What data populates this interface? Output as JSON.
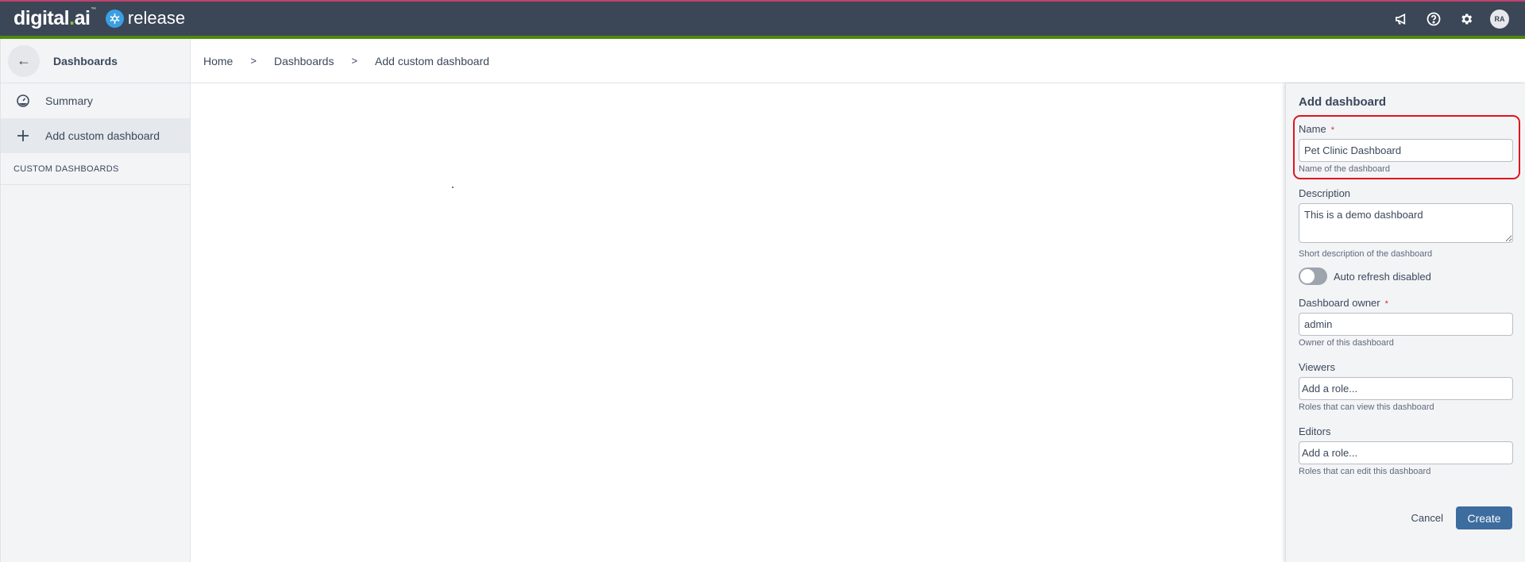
{
  "header": {
    "brand": "digital",
    "brand_suffix": "ai",
    "product": "release",
    "user_initials": "RA",
    "icons": [
      "megaphone-icon",
      "help-icon",
      "settings-icon"
    ]
  },
  "sidebar": {
    "title": "Dashboards",
    "items": [
      {
        "label": "Summary",
        "icon": "dashboard-gauge-icon"
      },
      {
        "label": "Add custom dashboard",
        "icon": "plus-icon",
        "active": true
      }
    ],
    "section_title": "CUSTOM DASHBOARDS"
  },
  "breadcrumb": [
    "Home",
    "Dashboards",
    "Add custom dashboard"
  ],
  "panel": {
    "title": "Add dashboard",
    "name": {
      "label": "Name",
      "required": "*",
      "value": "Pet Clinic Dashboard",
      "help": "Name of the dashboard"
    },
    "description": {
      "label": "Description",
      "value": "This is a demo dashboard",
      "help": "Short description of the dashboard"
    },
    "auto_refresh": {
      "label": "Auto refresh disabled",
      "enabled": false
    },
    "owner": {
      "label": "Dashboard owner",
      "required": "*",
      "value": "admin",
      "help": "Owner of this dashboard"
    },
    "viewers": {
      "label": "Viewers",
      "placeholder": "Add a role...",
      "help": "Roles that can view this dashboard"
    },
    "editors": {
      "label": "Editors",
      "placeholder": "Add a role...",
      "help": "Roles that can edit this dashboard"
    },
    "cancel_label": "Cancel",
    "create_label": "Create"
  },
  "colors": {
    "topbar": "#3b4657",
    "accent_green": "#4e8a0a",
    "primary_button": "#3d6c9e",
    "highlight": "#e0141e"
  }
}
